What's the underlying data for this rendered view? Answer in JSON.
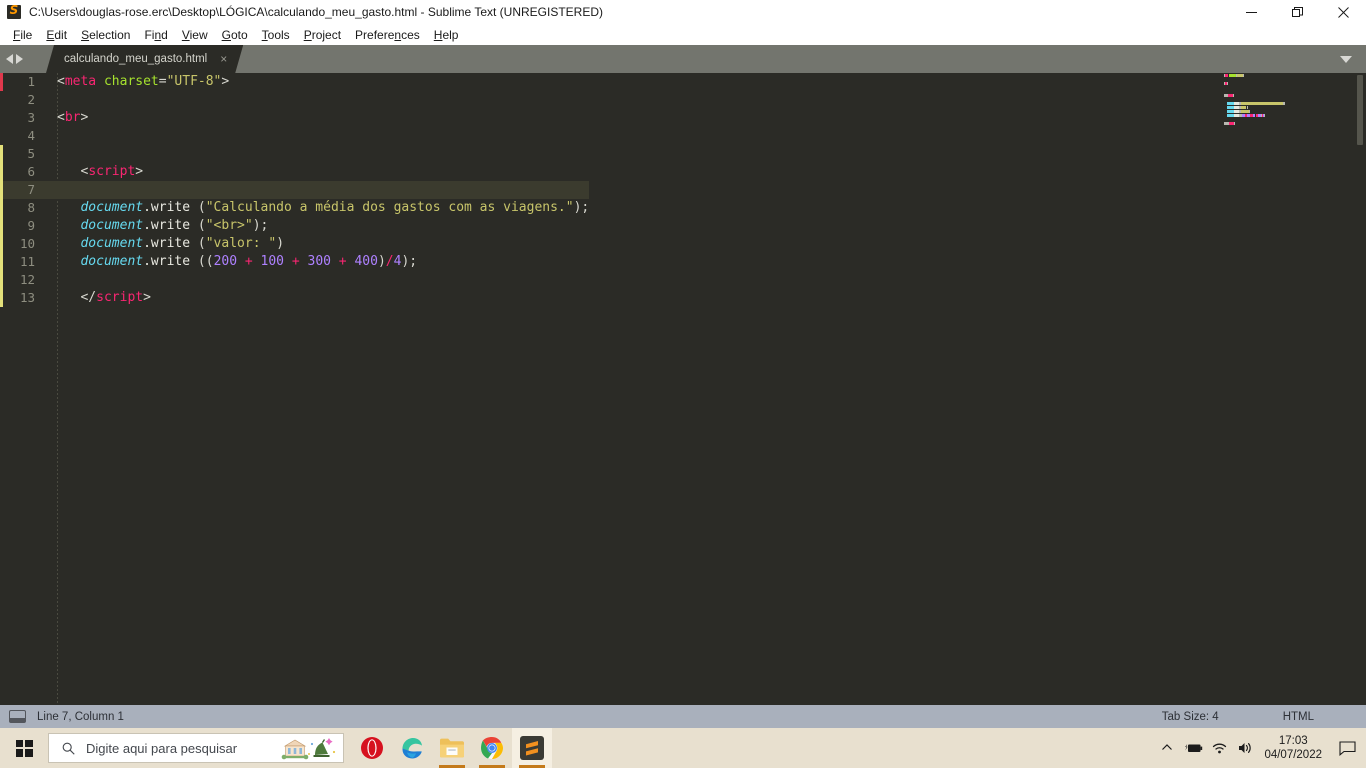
{
  "window": {
    "title": "C:\\Users\\douglas-rose.erc\\Desktop\\LÓGICA\\calculando_meu_gasto.html - Sublime Text (UNREGISTERED)",
    "app_icon": "sublime-text-icon",
    "controls": {
      "minimize": "minimize-icon",
      "restore": "restore-icon",
      "close": "close-icon"
    }
  },
  "menubar": {
    "items": [
      {
        "label": "File",
        "mnemonic": "F"
      },
      {
        "label": "Edit",
        "mnemonic": "E"
      },
      {
        "label": "Selection",
        "mnemonic": "S"
      },
      {
        "label": "Find",
        "mnemonic": "n"
      },
      {
        "label": "View",
        "mnemonic": "V"
      },
      {
        "label": "Goto",
        "mnemonic": "G"
      },
      {
        "label": "Tools",
        "mnemonic": "T"
      },
      {
        "label": "Project",
        "mnemonic": "P"
      },
      {
        "label": "Preferences",
        "mnemonic": "n"
      },
      {
        "label": "Help",
        "mnemonic": "H"
      }
    ]
  },
  "tabbar": {
    "prev_label": "◀",
    "next_label": "▶",
    "tabs": [
      {
        "label": "calculando_meu_gasto.html",
        "close_label": "×",
        "active": true
      }
    ],
    "dropdown": "tab-list-dropdown-icon"
  },
  "editor": {
    "lines": [
      {
        "num": "1",
        "marker": "red",
        "active": false,
        "tokens": [
          {
            "t": "<",
            "c": "s-punct"
          },
          {
            "t": "meta",
            "c": "s-tag"
          },
          {
            "t": " ",
            "c": "s-punct"
          },
          {
            "t": "charset",
            "c": "s-attr"
          },
          {
            "t": "=",
            "c": "s-punct"
          },
          {
            "t": "\"UTF-8\"",
            "c": "s-str"
          },
          {
            "t": ">",
            "c": "s-punct"
          }
        ]
      },
      {
        "num": "2",
        "marker": "none",
        "active": false,
        "tokens": []
      },
      {
        "num": "3",
        "marker": "none",
        "active": false,
        "tokens": [
          {
            "t": "<",
            "c": "s-punct"
          },
          {
            "t": "br",
            "c": "s-tag"
          },
          {
            "t": ">",
            "c": "s-punct"
          }
        ]
      },
      {
        "num": "4",
        "marker": "none",
        "active": false,
        "tokens": []
      },
      {
        "num": "5",
        "marker": "yellow",
        "active": false,
        "tokens": []
      },
      {
        "num": "6",
        "marker": "yellow",
        "active": false,
        "tokens": [
          {
            "t": "   <",
            "c": "s-punct"
          },
          {
            "t": "script",
            "c": "s-tag"
          },
          {
            "t": ">",
            "c": "s-punct"
          }
        ]
      },
      {
        "num": "7",
        "marker": "yellow",
        "active": true,
        "tokens": []
      },
      {
        "num": "8",
        "marker": "yellow",
        "active": false,
        "tokens": [
          {
            "t": "   ",
            "c": "s-punct"
          },
          {
            "t": "document",
            "c": "s-var"
          },
          {
            "t": ".write",
            "c": "s-prop"
          },
          {
            "t": " (",
            "c": "s-punct"
          },
          {
            "t": "\"Calculando a média dos gastos com as viagens.\"",
            "c": "s-str"
          },
          {
            "t": ");",
            "c": "s-punct"
          }
        ]
      },
      {
        "num": "9",
        "marker": "yellow",
        "active": false,
        "tokens": [
          {
            "t": "   ",
            "c": "s-punct"
          },
          {
            "t": "document",
            "c": "s-var"
          },
          {
            "t": ".write",
            "c": "s-prop"
          },
          {
            "t": " (",
            "c": "s-punct"
          },
          {
            "t": "\"<br>\"",
            "c": "s-str"
          },
          {
            "t": ");",
            "c": "s-punct"
          }
        ]
      },
      {
        "num": "10",
        "marker": "yellow",
        "active": false,
        "tokens": [
          {
            "t": "   ",
            "c": "s-punct"
          },
          {
            "t": "document",
            "c": "s-var"
          },
          {
            "t": ".write",
            "c": "s-prop"
          },
          {
            "t": " (",
            "c": "s-punct"
          },
          {
            "t": "\"valor: \"",
            "c": "s-str"
          },
          {
            "t": ")",
            "c": "s-punct"
          }
        ]
      },
      {
        "num": "11",
        "marker": "yellow",
        "active": false,
        "tokens": [
          {
            "t": "   ",
            "c": "s-punct"
          },
          {
            "t": "document",
            "c": "s-var"
          },
          {
            "t": ".write",
            "c": "s-prop"
          },
          {
            "t": " ((",
            "c": "s-punct"
          },
          {
            "t": "200",
            "c": "s-num"
          },
          {
            "t": " + ",
            "c": "s-op"
          },
          {
            "t": "100",
            "c": "s-num"
          },
          {
            "t": " + ",
            "c": "s-op"
          },
          {
            "t": "300",
            "c": "s-num"
          },
          {
            "t": " + ",
            "c": "s-op"
          },
          {
            "t": "400",
            "c": "s-num"
          },
          {
            "t": ")",
            "c": "s-punct"
          },
          {
            "t": "/",
            "c": "s-op"
          },
          {
            "t": "4",
            "c": "s-num"
          },
          {
            "t": ");",
            "c": "s-punct"
          }
        ]
      },
      {
        "num": "12",
        "marker": "yellow",
        "active": false,
        "tokens": []
      },
      {
        "num": "13",
        "marker": "yellow",
        "active": false,
        "tokens": [
          {
            "t": "   </",
            "c": "s-punct"
          },
          {
            "t": "script",
            "c": "s-tag"
          },
          {
            "t": ">",
            "c": "s-punct"
          }
        ]
      }
    ]
  },
  "statusbar": {
    "sidebar_toggle": "sidebar-toggle-icon",
    "cursor_position": "Line 7, Column 1",
    "tab_size": "Tab Size: 4",
    "syntax": "HTML"
  },
  "taskbar": {
    "start": "windows-start-icon",
    "search": {
      "placeholder": "Digite aqui para pesquisar",
      "icon": "search-icon",
      "artwork": "museum-bell-illustration"
    },
    "apps": [
      {
        "name": "opera",
        "label": "Opera",
        "active": false,
        "running": false
      },
      {
        "name": "microsoft-edge",
        "label": "Microsoft Edge",
        "active": false,
        "running": false
      },
      {
        "name": "file-explorer",
        "label": "File Explorer",
        "active": false,
        "running": true
      },
      {
        "name": "google-chrome",
        "label": "Google Chrome",
        "active": false,
        "running": true
      },
      {
        "name": "sublime-text",
        "label": "Sublime Text",
        "active": true,
        "running": true
      }
    ],
    "tray": {
      "show_hidden": "chevron-up-icon",
      "battery": "battery-charging-icon",
      "network": "wifi-icon",
      "volume": "volume-icon",
      "time": "17:03",
      "date": "04/07/2022",
      "action_center": "notifications-icon"
    }
  },
  "colors": {
    "editor_bg": "#2b2b26",
    "tabbar_bg": "#73756e",
    "statusbar_bg": "#a9b0bc",
    "taskbar_bg": "#e8e0cf",
    "accent_tag": "#f92672",
    "accent_string": "#c8c56a",
    "accent_number": "#ae81ff",
    "accent_variable": "#66d9ef",
    "marker_yellow": "#e3e07a",
    "marker_red": "#e0384c"
  }
}
